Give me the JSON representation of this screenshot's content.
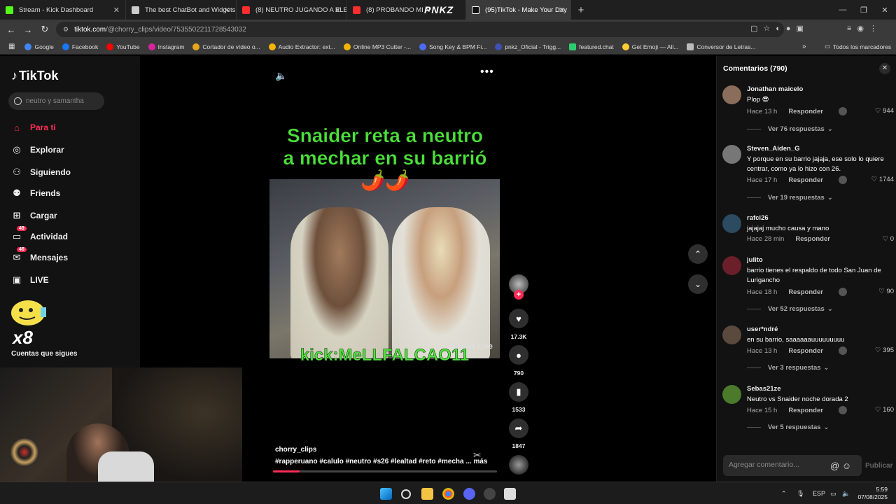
{
  "browser": {
    "tabs": [
      {
        "label": "Stream - Kick Dashboard",
        "color": "#53fc18"
      },
      {
        "label": "The best ChatBot and Widgets",
        "color": "#cccccc"
      },
      {
        "label": "(8) NEUTRO JUGANDO A ELECT",
        "color": "#ff2e2e"
      },
      {
        "label": "(8) PROBANDO MI N",
        "color": "#ff2e2e"
      },
      {
        "label": "(95)TikTok - Make Your Day",
        "color": "#111111"
      }
    ],
    "brand_overlay": "PNKZ",
    "url_host": "tiktok.com",
    "url_path": "/@chorry_clips/video/7535502211728543032",
    "bookmarks": [
      "Google",
      "Facebook",
      "YouTube",
      "Instagram",
      "Cortador de vídeo o...",
      "Audio Extractor: ext...",
      "Online MP3 Cutter -...",
      "Song Key & BPM Fi...",
      "pnkz_Oficial - Trigg...",
      "featured.chat",
      "Get Emoji — All...",
      "Conversor de Letras..."
    ],
    "bookmarks_all": "Todos los marcadores"
  },
  "sidebar": {
    "logo": "TikTok",
    "search_placeholder": "neutro y samantha",
    "items": [
      {
        "label": "Para ti",
        "icon": "home-icon",
        "active": true
      },
      {
        "label": "Explorar",
        "icon": "compass-icon"
      },
      {
        "label": "Siguiendo",
        "icon": "following-icon"
      },
      {
        "label": "Friends",
        "icon": "friends-icon"
      },
      {
        "label": "Cargar",
        "icon": "upload-icon"
      },
      {
        "label": "Actividad",
        "icon": "activity-icon",
        "badge": "49"
      },
      {
        "label": "Mensajes",
        "icon": "messages-icon",
        "badge": "46"
      },
      {
        "label": "LIVE",
        "icon": "live-icon"
      }
    ],
    "following_title": "Cuentas que sigues",
    "overlay_text": "x8"
  },
  "video": {
    "caption": "Snaider reta a neutro a mechar en su barrió 🌶️🌶️",
    "kick_text": "kick:MeLLFALCAO11",
    "watermark": "PRISM Live",
    "author": "chorry_clips",
    "tags": "#rapperuano #calulo #neutro #s26 #lealtad #reto #mecha",
    "more_label": "más",
    "progress": 0.12,
    "likes": "17.3K",
    "comments": "790",
    "saves": "1533",
    "shares": "1847"
  },
  "comments_panel": {
    "title": "Comentarios (790)",
    "input_placeholder": "Agregar comentario...",
    "post_label": "Publicar",
    "reply_label": "Responder",
    "items": [
      {
        "user": "Jonathan maicelo",
        "text": "Plop 😎",
        "time": "Hace 13 h",
        "likes": "944",
        "replies": "Ver 76 respuestas",
        "avatar": "#8a6d5a"
      },
      {
        "user": "Steven_Aiden_G",
        "text": "Y porque en su barrio jajaja, ese solo lo quiere centrar, como ya lo hizo con 26.",
        "time": "Hace 17 h",
        "likes": "1744",
        "replies": "Ver 19 respuestas",
        "avatar": "#777777"
      },
      {
        "user": "rafci26",
        "text": "jajajaj mucho causa y mano",
        "time": "Hace 28 min",
        "likes": "0",
        "replies": "",
        "avatar": "#2c4a60"
      },
      {
        "user": "julito",
        "text": "barrio tienes el respaldo de todo San Juan de Lurigancho",
        "time": "Hace 18 h",
        "likes": "90",
        "replies": "Ver 52 respuestas",
        "avatar": "#6b1f2a"
      },
      {
        "user": "user*ndré",
        "text": "en su barrio, saaaaaauuuuuuuuu",
        "time": "Hace 13 h",
        "likes": "395",
        "replies": "Ver 3 respuestas",
        "avatar": "#5a4a3d"
      },
      {
        "user": "Sebas21ze",
        "text": "Neutro vs Snaider noche dorada 2",
        "time": "Hace 15 h",
        "likes": "160",
        "replies": "Ver 5 respuestas",
        "avatar": "#4b7a2a"
      }
    ]
  },
  "taskbar": {
    "lang": "ESP",
    "time": "5:59",
    "date": "07/08/2025"
  }
}
